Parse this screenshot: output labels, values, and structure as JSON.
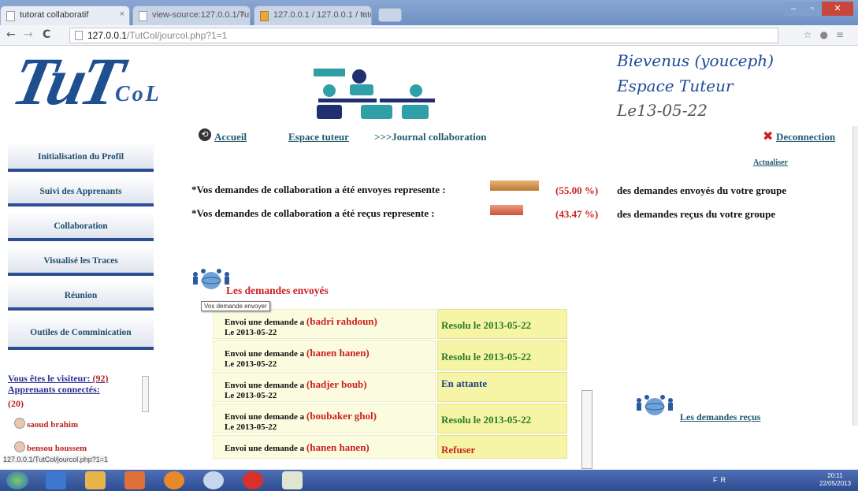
{
  "browser": {
    "tabs": [
      {
        "label": "tutorat collaboratif"
      },
      {
        "label": "view-source:127.0.0.1/Tut"
      },
      {
        "label": "127.0.0.1 / 127.0.0.1 / tutco"
      }
    ],
    "url_host": "127.0.0.1",
    "url_path": "/TutCol/jourcol.php?1=1",
    "status_url": "127.0.0.1/TutCol/jourcol.php?1=1"
  },
  "header": {
    "logo_text": "TuT",
    "logo_sub": "CoL",
    "greeting": "Bievenus (youceph)",
    "space": "Espace Tuteur",
    "date": "Le13-05-22"
  },
  "topnav": {
    "home": "Accueil",
    "tutor_space": "Espace tuteur",
    "journal": ">>>Journal collaboration",
    "logout": "Deconnection"
  },
  "sidebar": {
    "items": [
      {
        "label": "Initialisation du Profil"
      },
      {
        "label": "Suivi des Apprenants"
      },
      {
        "label": "Collaboration"
      },
      {
        "label": "Visualisé les Traces"
      },
      {
        "label": "Réunion"
      },
      {
        "label": "Outiles de Comminication"
      }
    ],
    "visitor_label": "Vous êtes le visiteur:",
    "visitor_count": "(92)",
    "connected_label": "Apprenants connectés:",
    "connected_count": "(20)",
    "users": [
      "saoud brahim",
      "bensou houssem"
    ]
  },
  "main": {
    "refresh": "Actualiser",
    "stats": [
      {
        "text": "*Vos demandes de collaboration a été envoyes represente :",
        "percent": "(55.00 %)",
        "tail": "des demandes envoyés du votre groupe",
        "color": "#c98a3a"
      },
      {
        "text": "*Vos demandes de collaboration a été reçus represente :",
        "percent": "(43.47 %)",
        "tail": "des demandes reçus du votre groupe",
        "color": "#d4684f"
      }
    ],
    "sent_title": "Les demandes envoyés",
    "tooltip": "Vos demande envoyer",
    "received_title": "Les demandes reçus",
    "requests": [
      {
        "prefix": "Envoi une demande a",
        "who": "(badri rahdoun)",
        "date": "Le 2013-05-22",
        "status": "Resolu le 2013-05-22",
        "status_color": "#2b7a2b"
      },
      {
        "prefix": "Envoi une demande a",
        "who": "(hanen hanen)",
        "date": "Le 2013-05-22",
        "status": "Resolu le 2013-05-22",
        "status_color": "#2b7a2b"
      },
      {
        "prefix": "Envoi une demande a",
        "who": "(hadjer boub)",
        "date": "Le 2013-05-22",
        "status": "En attante",
        "status_color": "#1f3e8f"
      },
      {
        "prefix": "Envoi une demande a",
        "who": "(boubaker ghol)",
        "date": "Le 2013-05-22",
        "status": "Resolu le 2013-05-22",
        "status_color": "#2b7a2b"
      },
      {
        "prefix": "Envoi une demande a",
        "who": "(hanen hanen)",
        "date": "",
        "status": "Refuser",
        "status_color": "#c22"
      }
    ]
  },
  "taskbar": {
    "tray": "FR",
    "clock_time": "20:11",
    "clock_date": "22/05/2013"
  }
}
